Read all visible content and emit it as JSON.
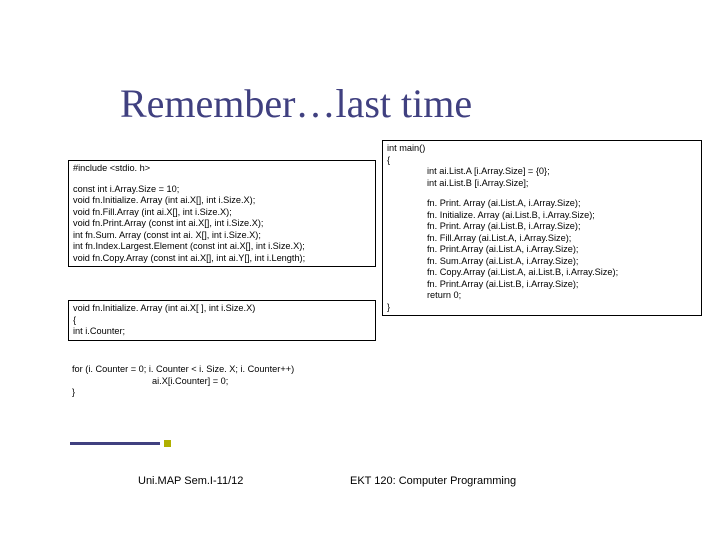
{
  "title": "Remember…last time",
  "left_box": {
    "l1": "#include <stdio. h>",
    "l2": "const int i.Array.Size = 10;",
    "l3": "void fn.Initialize. Array (int ai.X[], int i.Size.X);",
    "l4": "void fn.Fill.Array (int ai.X[], int i.Size.X);",
    "l5": "void fn.Print.Array (const int ai.X[], int i.Size.X);",
    "l6": "int fn.Sum. Array (const int ai. X[], int i.Size.X);",
    "l7": "int fn.Index.Largest.Element (const int ai.X[], int i.Size.X);",
    "l8": "void fn.Copy.Array (const int ai.X[], int ai.Y[], int i.Length);"
  },
  "left_box2": {
    "l1": "void fn.Initialize. Array (int ai.X[ ], int i.Size.X)",
    "l2": "{",
    "l3": "int i.Counter;"
  },
  "left_box3": {
    "l1": "for (i. Counter = 0; i. Counter < i. Size. X; i. Counter++)",
    "l2": "ai.X[i.Counter] = 0;",
    "l3": "}"
  },
  "right_box": {
    "l1": "int main()",
    "l2": "{",
    "l3": "int ai.List.A [i.Array.Size] = {0};",
    "l4": "int ai.List.B [i.Array.Size];",
    "l5": "fn. Print. Array (ai.List.A, i.Array.Size);",
    "l6": "fn. Initialize. Array (ai.List.B, i.Array.Size);",
    "l7": "fn. Print. Array (ai.List.B, i.Array.Size);",
    "l8": "fn. Fill.Array (ai.List.A, i.Array.Size);",
    "l9": "fn. Print.Array (ai.List.A, i.Array.Size);",
    "l10": "fn. Sum.Array (ai.List.A, i.Array.Size);",
    "l11": "fn. Copy.Array (ai.List.A, ai.List.B, i.Array.Size);",
    "l12": "fn. Print.Array (ai.List.B, i.Array.Size);",
    "l13": "return 0;",
    "l14": "}"
  },
  "footer": {
    "left": "Uni.MAP Sem.I-11/12",
    "right": "EKT 120: Computer Programming"
  }
}
